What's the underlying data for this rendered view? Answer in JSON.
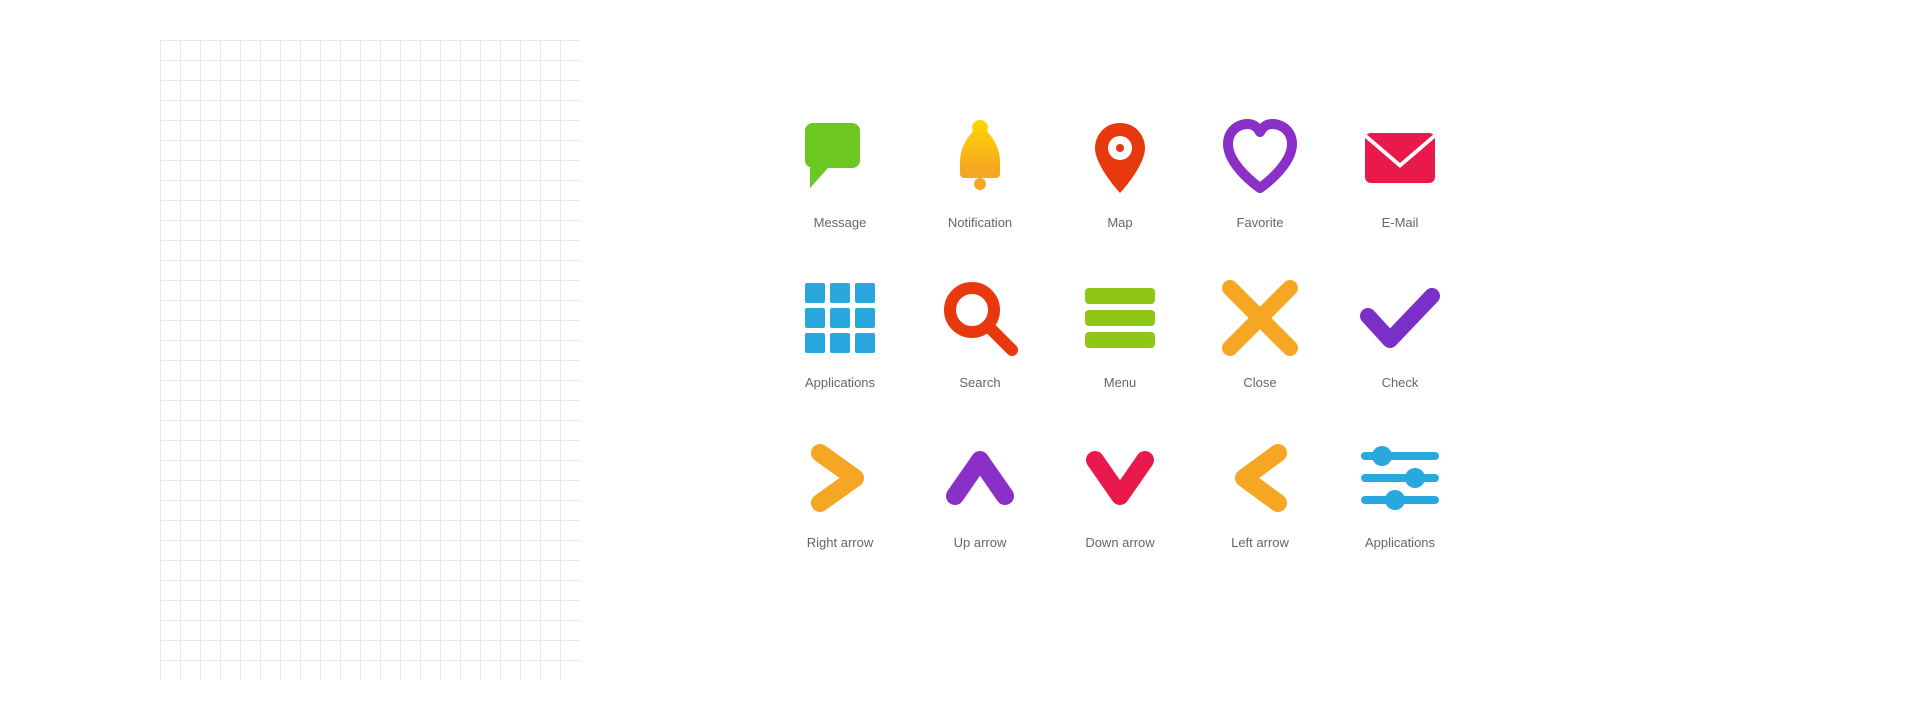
{
  "grid": {
    "description": "grid background"
  },
  "icons": {
    "row1": [
      {
        "name": "message-icon",
        "label": "Message"
      },
      {
        "name": "notification-icon",
        "label": "Notification"
      },
      {
        "name": "map-icon",
        "label": "Map"
      },
      {
        "name": "favorite-icon",
        "label": "Favorite"
      },
      {
        "name": "email-icon",
        "label": "E-Mail"
      }
    ],
    "row2": [
      {
        "name": "applications-icon",
        "label": "Applications"
      },
      {
        "name": "search-icon",
        "label": "Search"
      },
      {
        "name": "menu-icon",
        "label": "Menu"
      },
      {
        "name": "close-icon",
        "label": "Close"
      },
      {
        "name": "check-icon",
        "label": "Check"
      }
    ],
    "row3": [
      {
        "name": "right-arrow-icon",
        "label": "Right arrow"
      },
      {
        "name": "up-arrow-icon",
        "label": "Up arrow"
      },
      {
        "name": "down-arrow-icon",
        "label": "Down arrow"
      },
      {
        "name": "left-arrow-icon",
        "label": "Left arrow"
      },
      {
        "name": "applications2-icon",
        "label": "Applications"
      }
    ]
  }
}
